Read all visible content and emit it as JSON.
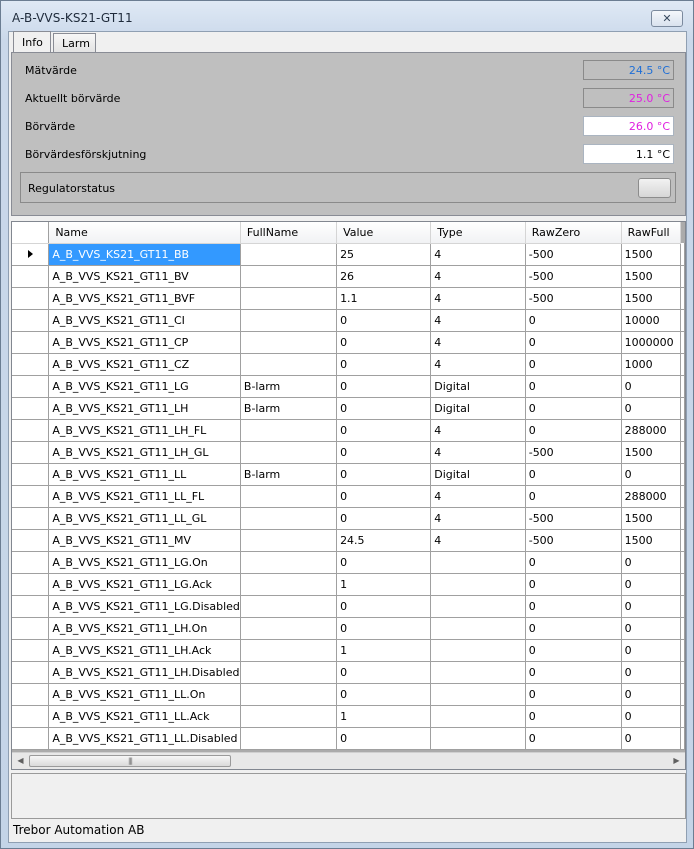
{
  "window": {
    "title": "A-B-VVS-KS21-GT11",
    "close_glyph": "✕"
  },
  "tabs": [
    {
      "label": "Info",
      "active": true
    },
    {
      "label": "Larm",
      "active": false
    }
  ],
  "info": {
    "matvarde": {
      "label": "Mätvärde",
      "value": "24.5 °C",
      "color": "#1f6fd6"
    },
    "aktuellt_borvarde": {
      "label": "Aktuellt börvärde",
      "value": "25.0 °C",
      "color": "#e020e0"
    },
    "borvarde": {
      "label": "Börvärde",
      "value": "26.0 °C",
      "color": "#e020e0"
    },
    "forskjutning": {
      "label": "Börvärdesförskjutning",
      "value": "1.1 °C",
      "color": "#000000"
    },
    "regulatorstatus": {
      "label": "Regulatorstatus"
    }
  },
  "grid": {
    "columns": [
      "Name",
      "FullName",
      "Value",
      "Type",
      "RawZero",
      "RawFull"
    ],
    "selected_row": 0,
    "rows": [
      [
        "A_B_VVS_KS21_GT11_BB",
        "",
        "25",
        "4",
        "-500",
        "1500"
      ],
      [
        "A_B_VVS_KS21_GT11_BV",
        "",
        "26",
        "4",
        "-500",
        "1500"
      ],
      [
        "A_B_VVS_KS21_GT11_BVF",
        "",
        "1.1",
        "4",
        "-500",
        "1500"
      ],
      [
        "A_B_VVS_KS21_GT11_CI",
        "",
        "0",
        "4",
        "0",
        "10000"
      ],
      [
        "A_B_VVS_KS21_GT11_CP",
        "",
        "0",
        "4",
        "0",
        "1000000"
      ],
      [
        "A_B_VVS_KS21_GT11_CZ",
        "",
        "0",
        "4",
        "0",
        "1000"
      ],
      [
        "A_B_VVS_KS21_GT11_LG",
        "B-larm",
        "0",
        "Digital",
        "0",
        "0"
      ],
      [
        "A_B_VVS_KS21_GT11_LH",
        "B-larm",
        "0",
        "Digital",
        "0",
        "0"
      ],
      [
        "A_B_VVS_KS21_GT11_LH_FL",
        "",
        "0",
        "4",
        "0",
        "288000"
      ],
      [
        "A_B_VVS_KS21_GT11_LH_GL",
        "",
        "0",
        "4",
        "-500",
        "1500"
      ],
      [
        "A_B_VVS_KS21_GT11_LL",
        "B-larm",
        "0",
        "Digital",
        "0",
        "0"
      ],
      [
        "A_B_VVS_KS21_GT11_LL_FL",
        "",
        "0",
        "4",
        "0",
        "288000"
      ],
      [
        "A_B_VVS_KS21_GT11_LL_GL",
        "",
        "0",
        "4",
        "-500",
        "1500"
      ],
      [
        "A_B_VVS_KS21_GT11_MV",
        "",
        "24.5",
        "4",
        "-500",
        "1500"
      ],
      [
        "A_B_VVS_KS21_GT11_LG.On",
        "",
        "0",
        "",
        "0",
        "0"
      ],
      [
        "A_B_VVS_KS21_GT11_LG.Ack",
        "",
        "1",
        "",
        "0",
        "0"
      ],
      [
        "A_B_VVS_KS21_GT11_LG.Disabled",
        "",
        "0",
        "",
        "0",
        "0"
      ],
      [
        "A_B_VVS_KS21_GT11_LH.On",
        "",
        "0",
        "",
        "0",
        "0"
      ],
      [
        "A_B_VVS_KS21_GT11_LH.Ack",
        "",
        "1",
        "",
        "0",
        "0"
      ],
      [
        "A_B_VVS_KS21_GT11_LH.Disabled",
        "",
        "0",
        "",
        "0",
        "0"
      ],
      [
        "A_B_VVS_KS21_GT11_LL.On",
        "",
        "0",
        "",
        "0",
        "0"
      ],
      [
        "A_B_VVS_KS21_GT11_LL.Ack",
        "",
        "1",
        "",
        "0",
        "0"
      ],
      [
        "A_B_VVS_KS21_GT11_LL.Disabled",
        "",
        "0",
        "",
        "0",
        "0"
      ]
    ]
  },
  "scrollbar": {
    "left_arrow": "◀",
    "right_arrow": "▶",
    "grip": "|||"
  },
  "statusbar": {
    "text": "Trebor Automation AB"
  }
}
